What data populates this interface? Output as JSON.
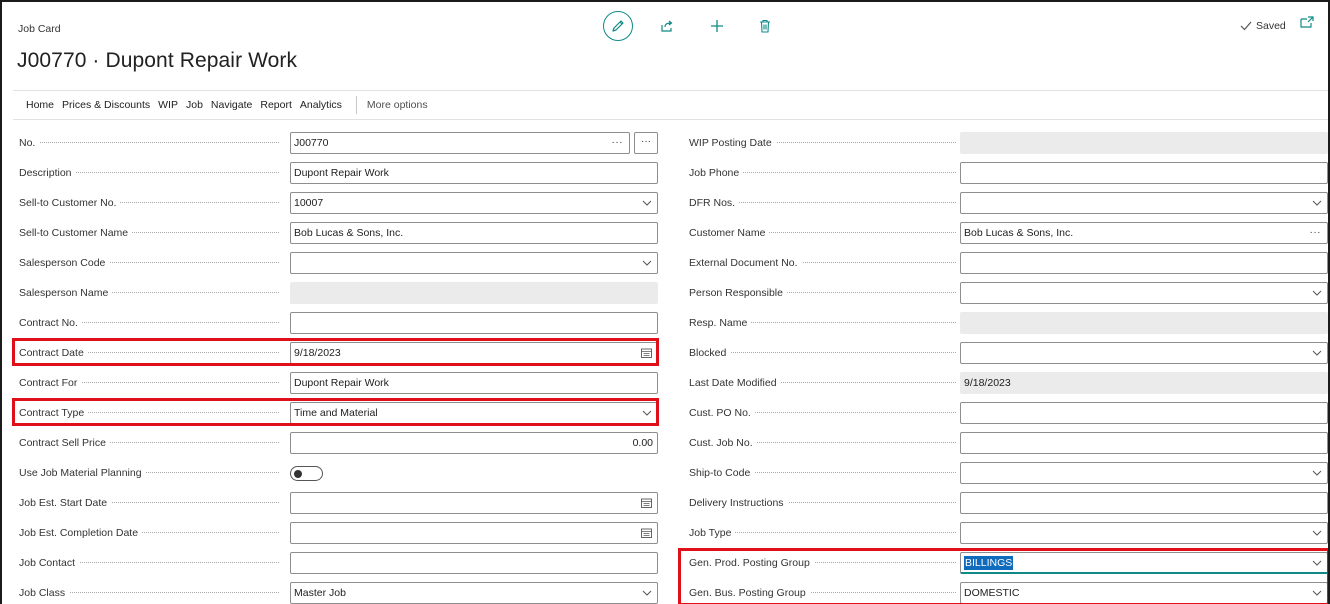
{
  "header": {
    "top_label": "Job Card",
    "title": "J00770 · Dupont Repair Work",
    "saved_label": "Saved"
  },
  "menu": {
    "items": [
      "Home",
      "Prices & Discounts",
      "WIP",
      "Job",
      "Navigate",
      "Report",
      "Analytics"
    ],
    "more": "More options"
  },
  "left_fields": [
    {
      "label": "No.",
      "value": "J00770"
    },
    {
      "label": "Description",
      "value": "Dupont Repair Work"
    },
    {
      "label": "Sell-to Customer No.",
      "value": "10007"
    },
    {
      "label": "Sell-to Customer Name",
      "value": "Bob Lucas & Sons, Inc."
    },
    {
      "label": "Salesperson Code",
      "value": ""
    },
    {
      "label": "Salesperson Name",
      "value": ""
    },
    {
      "label": "Contract No.",
      "value": ""
    },
    {
      "label": "Contract Date",
      "value": "9/18/2023"
    },
    {
      "label": "Contract For",
      "value": "Dupont Repair Work"
    },
    {
      "label": "Contract Type",
      "value": "Time and Material"
    },
    {
      "label": "Contract Sell Price",
      "value": "0.00"
    },
    {
      "label": "Use Job Material Planning",
      "value": false
    },
    {
      "label": "Job Est. Start Date",
      "value": ""
    },
    {
      "label": "Job Est. Completion Date",
      "value": ""
    },
    {
      "label": "Job Contact",
      "value": ""
    },
    {
      "label": "Job Class",
      "value": "Master Job"
    }
  ],
  "right_fields": [
    {
      "label": "WIP Posting Date",
      "value": ""
    },
    {
      "label": "Job Phone",
      "value": ""
    },
    {
      "label": "DFR Nos.",
      "value": ""
    },
    {
      "label": "Customer Name",
      "value": "Bob Lucas & Sons, Inc."
    },
    {
      "label": "External Document No.",
      "value": ""
    },
    {
      "label": "Person Responsible",
      "value": ""
    },
    {
      "label": "Resp. Name",
      "value": ""
    },
    {
      "label": "Blocked",
      "value": ""
    },
    {
      "label": "Last Date Modified",
      "value": "9/18/2023"
    },
    {
      "label": "Cust. PO No.",
      "value": ""
    },
    {
      "label": "Cust. Job No.",
      "value": ""
    },
    {
      "label": "Ship-to Code",
      "value": ""
    },
    {
      "label": "Delivery Instructions",
      "value": ""
    },
    {
      "label": "Job Type",
      "value": ""
    },
    {
      "label": "Gen. Prod. Posting Group",
      "value": "BILLINGS"
    },
    {
      "label": "Gen. Bus. Posting Group",
      "value": "DOMESTIC"
    }
  ],
  "colors": {
    "accent": "#0f8a87",
    "highlight": "#e0101a",
    "selection": "#0f6cbd",
    "readonly_bg": "#ebebeb"
  },
  "icons": {
    "edit": "pencil-icon",
    "share": "share-icon",
    "new": "plus-icon",
    "delete": "trash-icon",
    "saved": "check-icon",
    "popout": "popout-icon",
    "dropdown": "chevron-down-icon",
    "calendar": "calendar-icon",
    "assist": "ellipsis-icon"
  }
}
